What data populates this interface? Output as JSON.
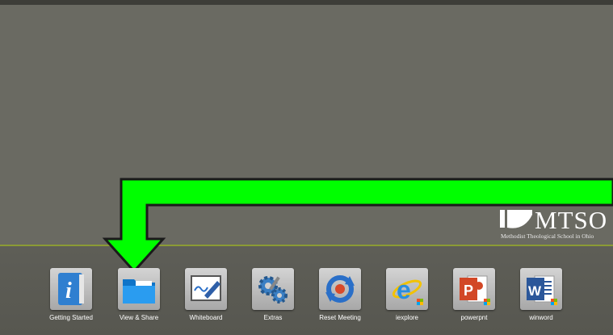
{
  "branding": {
    "logo_text": "MTSO",
    "logo_subtitle": "Methodist Theological School in Ohio"
  },
  "taskbar": {
    "apps": [
      {
        "label": "Getting Started",
        "icon": "info-book-icon"
      },
      {
        "label": "View & Share",
        "icon": "folder-icon"
      },
      {
        "label": "Whiteboard",
        "icon": "whiteboard-marker-icon"
      },
      {
        "label": "Extras",
        "icon": "gears-icon"
      },
      {
        "label": "Reset Meeting",
        "icon": "reset-arrows-icon"
      },
      {
        "label": "iexplore",
        "icon": "internet-explorer-icon"
      },
      {
        "label": "powerpnt",
        "icon": "powerpoint-icon"
      },
      {
        "label": "winword",
        "icon": "word-icon"
      }
    ]
  },
  "colors": {
    "background": "#6a6a62",
    "taskbar": "#5b5b54",
    "accent_line": "#8b9b35",
    "arrow": "#00ff00"
  }
}
